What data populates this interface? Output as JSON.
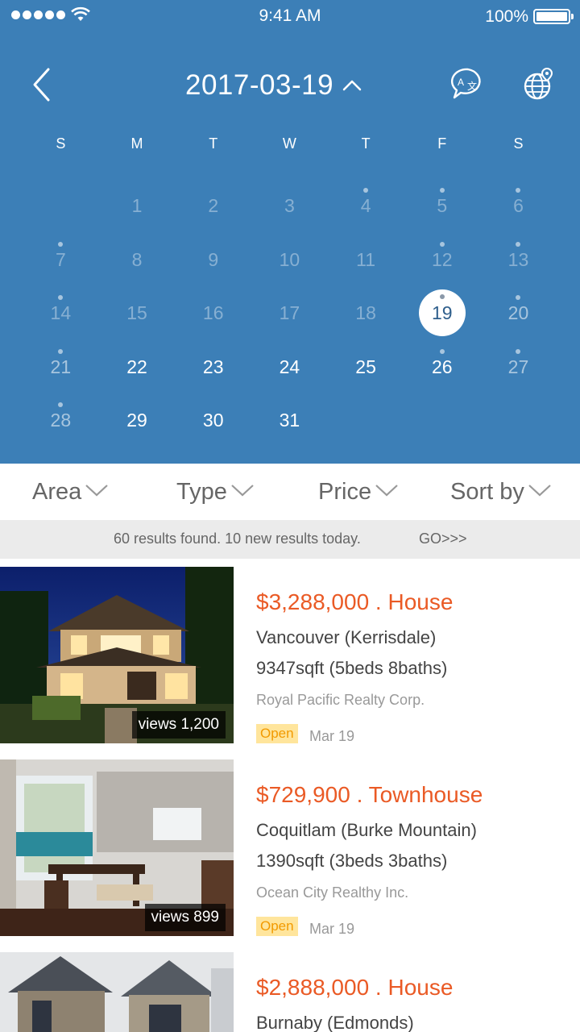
{
  "status_bar": {
    "time": "9:41 AM",
    "battery": "100%"
  },
  "header": {
    "date": "2017-03-19"
  },
  "calendar": {
    "weekdays": [
      "S",
      "M",
      "T",
      "W",
      "T",
      "F",
      "S"
    ],
    "days": [
      {
        "n": "",
        "s": "empty"
      },
      {
        "n": "1",
        "s": "faded",
        "dot": false
      },
      {
        "n": "2",
        "s": "faded",
        "dot": false
      },
      {
        "n": "3",
        "s": "faded",
        "dot": false
      },
      {
        "n": "4",
        "s": "faded",
        "dot": true
      },
      {
        "n": "5",
        "s": "faded",
        "dot": true
      },
      {
        "n": "6",
        "s": "faded",
        "dot": true
      },
      {
        "n": "7",
        "s": "faded",
        "dot": true
      },
      {
        "n": "8",
        "s": "faded",
        "dot": false
      },
      {
        "n": "9",
        "s": "faded",
        "dot": false
      },
      {
        "n": "10",
        "s": "faded",
        "dot": false
      },
      {
        "n": "11",
        "s": "faded",
        "dot": false
      },
      {
        "n": "12",
        "s": "faded",
        "dot": true
      },
      {
        "n": "13",
        "s": "faded",
        "dot": true
      },
      {
        "n": "14",
        "s": "faded",
        "dot": true
      },
      {
        "n": "15",
        "s": "faded",
        "dot": false
      },
      {
        "n": "16",
        "s": "faded",
        "dot": false
      },
      {
        "n": "17",
        "s": "faded",
        "dot": false
      },
      {
        "n": "18",
        "s": "faded",
        "dot": false
      },
      {
        "n": "19",
        "s": "selected",
        "dot": true
      },
      {
        "n": "20",
        "s": "dim",
        "dot": true
      },
      {
        "n": "21",
        "s": "dim",
        "dot": true
      },
      {
        "n": "22",
        "s": "active",
        "dot": false
      },
      {
        "n": "23",
        "s": "active",
        "dot": false
      },
      {
        "n": "24",
        "s": "active",
        "dot": false
      },
      {
        "n": "25",
        "s": "active",
        "dot": false
      },
      {
        "n": "26",
        "s": "active",
        "dot": true
      },
      {
        "n": "27",
        "s": "dim",
        "dot": true
      },
      {
        "n": "28",
        "s": "dim",
        "dot": true
      },
      {
        "n": "29",
        "s": "active",
        "dot": false
      },
      {
        "n": "30",
        "s": "active",
        "dot": false
      },
      {
        "n": "31",
        "s": "active",
        "dot": false
      }
    ]
  },
  "filters": [
    {
      "label": "Area"
    },
    {
      "label": "Type"
    },
    {
      "label": "Price"
    },
    {
      "label": "Sort by"
    }
  ],
  "results": {
    "text": "60 results found. 10 new results today.",
    "go": "GO>>>"
  },
  "listings": [
    {
      "price": "$3,288,000 . House",
      "area": "Vancouver (Kerrisdale)",
      "size": "9347sqft (5beds 8baths)",
      "agent": "Royal Pacific Realty Corp.",
      "badge": "Open",
      "date": "Mar 19",
      "views": "views 1,200"
    },
    {
      "price": "$729,900 . Townhouse",
      "area": "Coquitlam  (Burke Mountain)",
      "size": "1390sqft  (3beds 3baths)",
      "agent": "Ocean City Realthy Inc.",
      "badge": "Open",
      "date": "Mar 19",
      "views": "views 899"
    },
    {
      "price": "$2,888,000 . House",
      "area": "Burnaby  (Edmonds)"
    }
  ],
  "colors": {
    "header_blue": "#3c7fb7",
    "price_orange": "#ea5a25",
    "badge_bg": "#ffe59c",
    "badge_text": "#f29a00"
  }
}
